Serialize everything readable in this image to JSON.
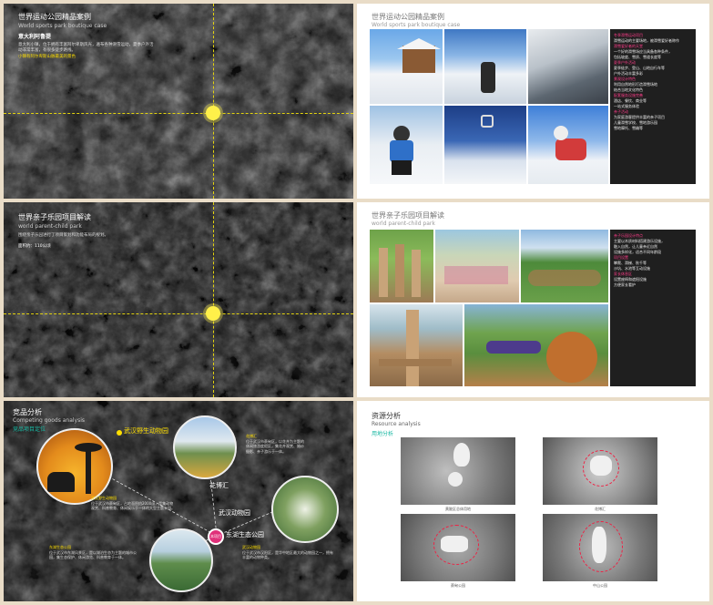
{
  "panel1": {
    "title": "世界运动公园精品案例",
    "subtitle": "World sports park boutique case",
    "heading": "意大利阿鲁提",
    "body": "意大利小镇，位于拥有丰富阿尔卑斯风光，遍布各种滑雪运动，夏季户外活动非常丰富，有很多徒步路线。",
    "highlight": "小镇有阿尔卑斯山脉最美的景色"
  },
  "panel2": {
    "title": "世界运动公园精品案例",
    "subtitle": "World sports park boutique case",
    "side_lines": [
      {
        "t": "冬季滑雪运动项目",
        "hl": true
      },
      {
        "t": "滑雪运动的主要场地，被滑雪爱好者称作",
        "hl": false
      },
      {
        "t": "滑雪爱好者的天堂",
        "hl": true
      },
      {
        "t": "一个好的滑雪场应当具备各种条件，",
        "hl": false
      },
      {
        "t": "包括坡度、雪质、雪道长度等",
        "hl": false
      },
      {
        "t": "夏季户外活动",
        "hl": true
      },
      {
        "t": "夏季徒步、登山、山地自行车等",
        "hl": false
      },
      {
        "t": "户外活动丰富多彩",
        "hl": false
      },
      {
        "t": "景观设计特色",
        "hl": true
      },
      {
        "t": "利用自然地形打造滑雪场地",
        "hl": false
      },
      {
        "t": "结合当地文化特色",
        "hl": false
      },
      {
        "t": "配套服务设施完善",
        "hl": true
      },
      {
        "t": "酒店、餐饮、商业等",
        "hl": false
      },
      {
        "t": "一站式服务体验",
        "hl": false
      },
      {
        "t": "亲子活动",
        "hl": true
      },
      {
        "t": "为家庭游客提供丰富的亲子项目",
        "hl": false
      },
      {
        "t": "儿童滑雪学校、雪地游乐园",
        "hl": false
      },
      {
        "t": "雪地摩托、雪橇等",
        "hl": false
      }
    ]
  },
  "panel3": {
    "title": "世界亲子乐园项目解读",
    "subtitle": "world parent-child park",
    "body": "围绕亲子乐园进行了项目策划和功能布局的规划。",
    "highlight": "面积约：110公顷"
  },
  "panel4": {
    "title": "世界亲子乐园项目解读",
    "subtitle": "world parent-child park",
    "side_lines": [
      {
        "t": "亲子乐园设计特点",
        "hl": true
      },
      {
        "t": "主要以木质材料搭建游乐设施，",
        "hl": false
      },
      {
        "t": "融入自然，让儿童亲近自然",
        "hl": false
      },
      {
        "t": "设施多样化，适合不同年龄段",
        "hl": false
      },
      {
        "t": "项目设置",
        "hl": true
      },
      {
        "t": "攀爬、滑梯、秋千等",
        "hl": false
      },
      {
        "t": "沙坑、水池等互动设施",
        "hl": false
      },
      {
        "t": "家长休息区",
        "hl": true
      },
      {
        "t": "设置座椅和遮阳设施",
        "hl": false
      },
      {
        "t": "方便家长看护",
        "hl": false
      }
    ]
  },
  "panel5": {
    "title": "竞品分析",
    "subtitle": "Competing goods analysis",
    "tag": "竞品项目定位",
    "labels": {
      "zoo": "武汉野生动物园",
      "huabo": "花博汇",
      "zoo2": "武汉动物园",
      "lake": "东湖生态公园"
    },
    "center_tag": "本项目",
    "boxes": [
      {
        "title": "武汉野生动物园",
        "text": "位于武汉市蔡甸区，占地面积约2000亩，是集动物观赏、科普教育、休闲娱乐于一体的大型主题公园。"
      },
      {
        "title": "花博汇",
        "text": "位于武汉市蔡甸区，以花卉为主题的休闲旅游度假区，集花卉观赏、婚纱摄影、亲子游乐于一体。"
      },
      {
        "title": "东湖生态公园",
        "text": "位于武汉市东湖风景区，是以湖泊生态为主题的城市公园，集生态保护、休闲游览、科普教育于一体。"
      },
      {
        "title": "武汉动物园",
        "text": "位于武汉市汉阳区，是华中地区最大的动物园之一，拥有丰富的动物种类。"
      }
    ]
  },
  "panel6": {
    "title": "资源分析",
    "subtitle": "Resource analysis",
    "tag": "用地分析",
    "captions": [
      "黄陂区总体用地",
      "花博汇",
      "蔡甸公园",
      "中山公园"
    ]
  },
  "colors": {
    "accent_yellow": "#ffdf00",
    "accent_pink": "#ff3e8a",
    "accent_teal": "#19b8a3",
    "beige_bg": "#e9dcc7"
  }
}
